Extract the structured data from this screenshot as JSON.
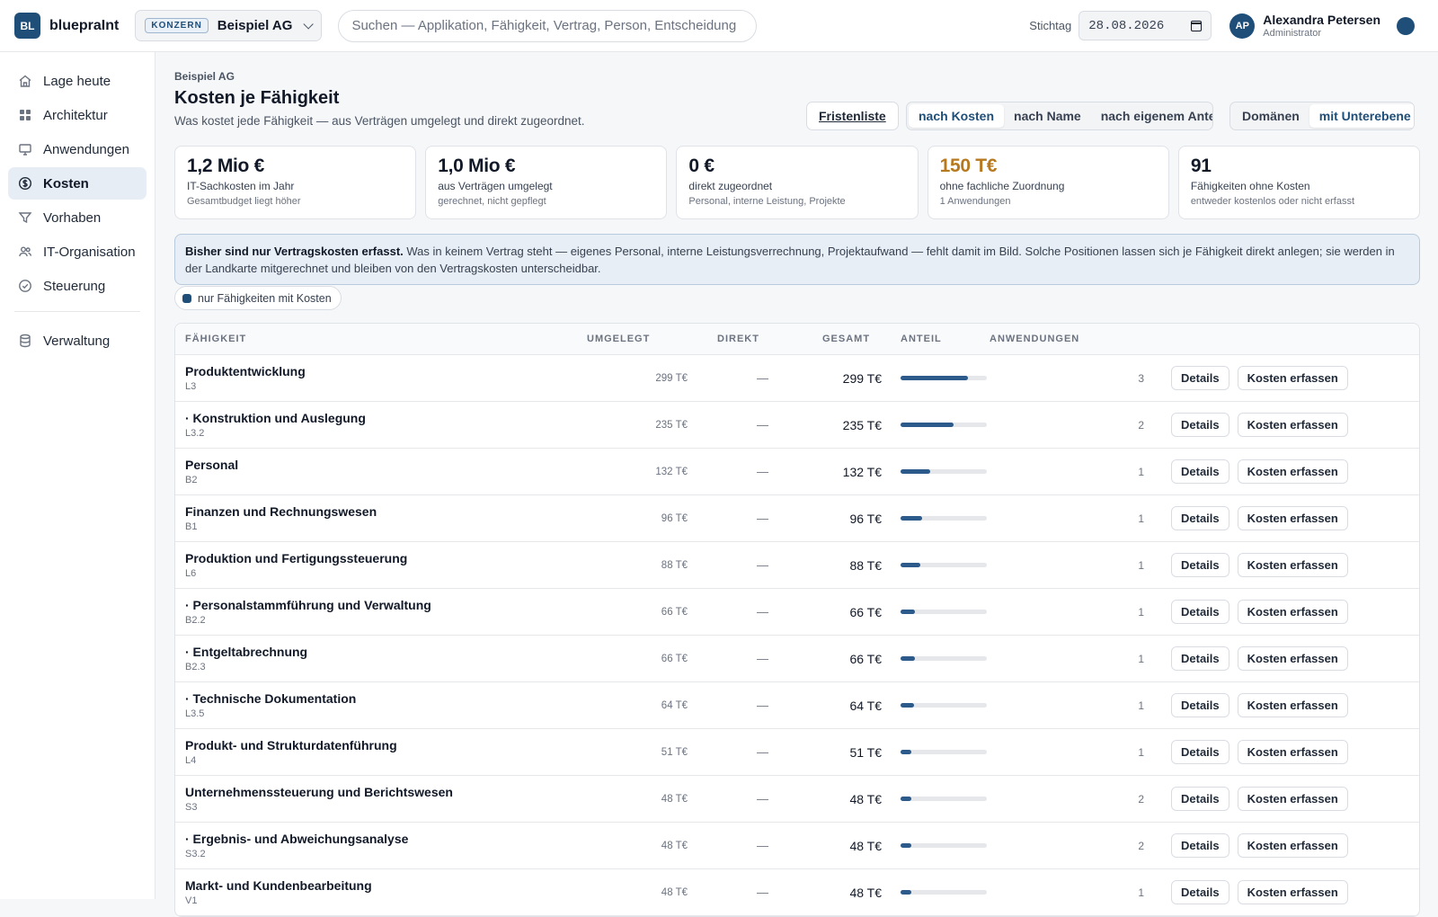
{
  "topbar": {
    "logo_initials": "BL",
    "brand": "bluepraInt",
    "tenant_badge": "KONZERN",
    "tenant_name": "Beispiel AG",
    "search_placeholder": "Suchen — Applikation, Fähigkeit, Vertrag, Person, Entscheidung",
    "stichtag_label": "Stichtag",
    "stichtag_value": "28.08.2026",
    "user_initials": "AP",
    "user_name": "Alexandra Petersen",
    "user_role": "Administrator"
  },
  "sidebar": {
    "items": [
      {
        "label": "Lage heute",
        "icon": "home-icon",
        "active": false
      },
      {
        "label": "Architektur",
        "icon": "grid-icon",
        "active": false
      },
      {
        "label": "Anwendungen",
        "icon": "monitor-icon",
        "active": false
      },
      {
        "label": "Kosten",
        "icon": "dollar-icon",
        "active": true
      },
      {
        "label": "Vorhaben",
        "icon": "filter-icon",
        "active": false
      },
      {
        "label": "IT-Organisation",
        "icon": "users-icon",
        "active": false
      },
      {
        "label": "Steuerung",
        "icon": "check-circle-icon",
        "active": false
      }
    ],
    "admin_item": {
      "label": "Verwaltung",
      "icon": "database-icon"
    }
  },
  "page": {
    "breadcrumb": "Beispiel AG",
    "title": "Kosten je Fähigkeit",
    "subtitle": "Was kostet jede Fähigkeit — aus Verträgen umgelegt und direkt zugeordnet.",
    "frist_button": "Fristenliste",
    "sort_options": [
      "nach Kosten",
      "nach Name",
      "nach eigenem Anteil"
    ],
    "sort_active": 0,
    "scope_options": [
      "Domänen",
      "mit Unterebene"
    ],
    "scope_active": 1
  },
  "kpis": [
    {
      "value": "1,2 Mio €",
      "label": "IT-Sachkosten im Jahr",
      "hint": "Gesamtbudget liegt höher",
      "warn": false
    },
    {
      "value": "1,0 Mio €",
      "label": "aus Verträgen umgelegt",
      "hint": "gerechnet, nicht gepflegt",
      "warn": false
    },
    {
      "value": "0 €",
      "label": "direkt zugeordnet",
      "hint": "Personal, interne Leistung, Projekte",
      "warn": false
    },
    {
      "value": "150 T€",
      "label": "ohne fachliche Zuordnung",
      "hint": "1 Anwendungen",
      "warn": true
    },
    {
      "value": "91",
      "label": "Fähigkeiten ohne Kosten",
      "hint": "entweder kostenlos oder nicht erfasst",
      "warn": false
    }
  ],
  "notice": {
    "bold": "Bisher sind nur Vertragskosten erfasst.",
    "text": " Was in keinem Vertrag steht — eigenes Personal, interne Leistungsverrechnung, Projektaufwand — fehlt damit im Bild. Solche Positionen lassen sich je Fähigkeit direkt anlegen; sie werden in der Landkarte mitgerechnet und bleiben von den Vertragskosten unterscheidbar."
  },
  "filter_chip": "nur Fähigkeiten mit Kosten",
  "table": {
    "headers": {
      "name": "FÄHIGKEIT",
      "umgelegt": "UMGELEGT",
      "direkt": "DIREKT",
      "gesamt": "GESAMT",
      "anteil": "ANTEIL",
      "anwendungen": "ANWENDUNGEN"
    },
    "details_label": "Details",
    "erfassen_label": "Kosten erfassen",
    "rows": [
      {
        "name": "Produktentwicklung",
        "code": "L3",
        "umgelegt": "299 T€",
        "direkt": "—",
        "gesamt": "299 T€",
        "anteil": 0.78,
        "anwendungen": "3"
      },
      {
        "name": "· Konstruktion und Auslegung",
        "code": "L3.2",
        "umgelegt": "235 T€",
        "direkt": "—",
        "gesamt": "235 T€",
        "anteil": 0.61,
        "anwendungen": "2"
      },
      {
        "name": "Personal",
        "code": "B2",
        "umgelegt": "132 T€",
        "direkt": "—",
        "gesamt": "132 T€",
        "anteil": 0.34,
        "anwendungen": "1"
      },
      {
        "name": "Finanzen und Rechnungswesen",
        "code": "B1",
        "umgelegt": "96 T€",
        "direkt": "—",
        "gesamt": "96 T€",
        "anteil": 0.25,
        "anwendungen": "1"
      },
      {
        "name": "Produktion und Fertigungssteuerung",
        "code": "L6",
        "umgelegt": "88 T€",
        "direkt": "—",
        "gesamt": "88 T€",
        "anteil": 0.23,
        "anwendungen": "1"
      },
      {
        "name": "· Personalstammführung und Verwaltung",
        "code": "B2.2",
        "umgelegt": "66 T€",
        "direkt": "—",
        "gesamt": "66 T€",
        "anteil": 0.17,
        "anwendungen": "1"
      },
      {
        "name": "· Entgeltabrechnung",
        "code": "B2.3",
        "umgelegt": "66 T€",
        "direkt": "—",
        "gesamt": "66 T€",
        "anteil": 0.17,
        "anwendungen": "1"
      },
      {
        "name": "· Technische Dokumentation",
        "code": "L3.5",
        "umgelegt": "64 T€",
        "direkt": "—",
        "gesamt": "64 T€",
        "anteil": 0.16,
        "anwendungen": "1"
      },
      {
        "name": "Produkt- und Strukturdatenführung",
        "code": "L4",
        "umgelegt": "51 T€",
        "direkt": "—",
        "gesamt": "51 T€",
        "anteil": 0.13,
        "anwendungen": "1"
      },
      {
        "name": "Unternehmenssteuerung und Berichtswesen",
        "code": "S3",
        "umgelegt": "48 T€",
        "direkt": "—",
        "gesamt": "48 T€",
        "anteil": 0.12,
        "anwendungen": "2"
      },
      {
        "name": "· Ergebnis- und Abweichungsanalyse",
        "code": "S3.2",
        "umgelegt": "48 T€",
        "direkt": "—",
        "gesamt": "48 T€",
        "anteil": 0.12,
        "anwendungen": "2"
      },
      {
        "name": "Markt- und Kundenbearbeitung",
        "code": "V1",
        "umgelegt": "48 T€",
        "direkt": "—",
        "gesamt": "48 T€",
        "anteil": 0.12,
        "anwendungen": "1"
      }
    ]
  }
}
